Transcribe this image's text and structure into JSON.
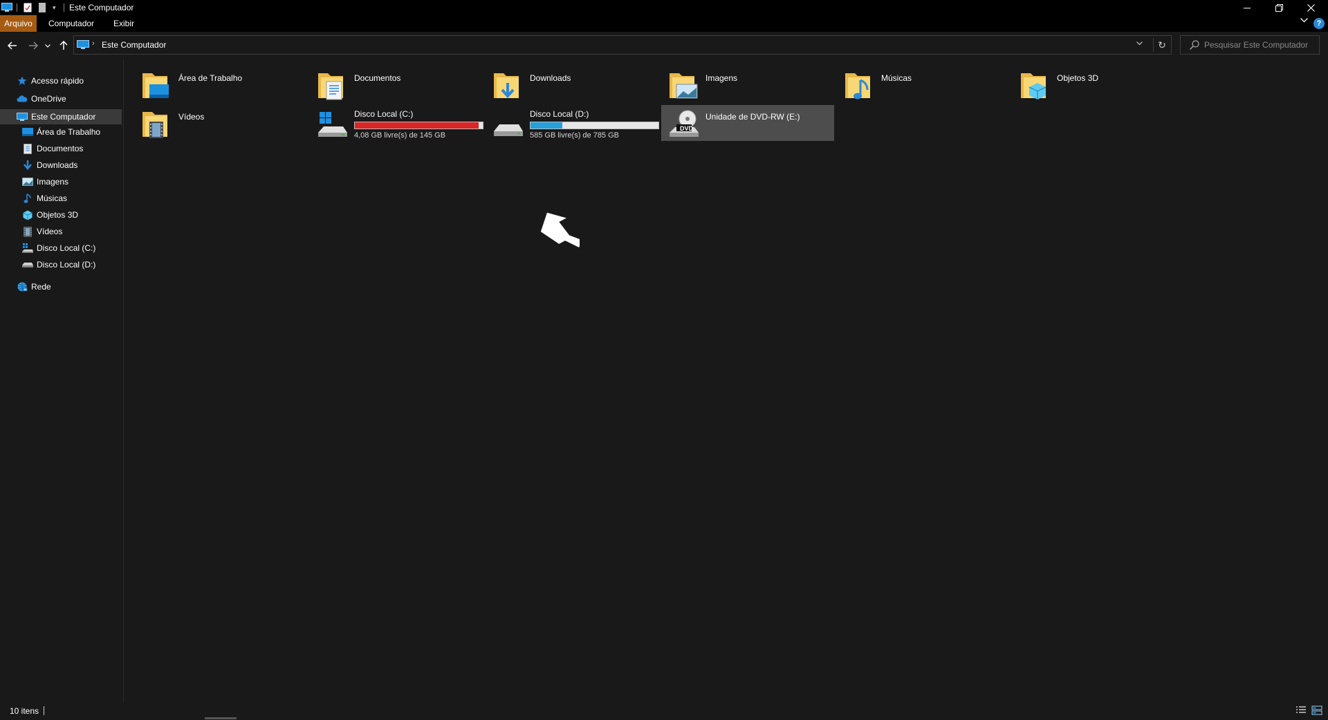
{
  "window": {
    "title": "Este Computador"
  },
  "ribbon": {
    "tabs": [
      {
        "label": "Arquivo"
      },
      {
        "label": "Computador"
      },
      {
        "label": "Exibir"
      }
    ],
    "help_label": "?"
  },
  "address": {
    "path_label": "Este Computador",
    "search_placeholder": "Pesquisar Este Computador"
  },
  "navpane": {
    "quick_access": "Acesso rápido",
    "onedrive": "OneDrive",
    "this_pc": "Este Computador",
    "children": [
      {
        "label": "Área de Trabalho",
        "icon": "desktop-icon"
      },
      {
        "label": "Documentos",
        "icon": "documents-icon"
      },
      {
        "label": "Downloads",
        "icon": "downloads-icon"
      },
      {
        "label": "Imagens",
        "icon": "pictures-icon"
      },
      {
        "label": "Músicas",
        "icon": "music-icon"
      },
      {
        "label": "Objetos 3D",
        "icon": "3d-objects-icon"
      },
      {
        "label": "Vídeos",
        "icon": "videos-icon"
      },
      {
        "label": "Disco Local (C:)",
        "icon": "system-drive-icon"
      },
      {
        "label": "Disco Local (D:)",
        "icon": "drive-icon"
      }
    ],
    "network": "Rede"
  },
  "folders": [
    {
      "label": "Área de Trabalho",
      "icon": "desktop-folder-icon"
    },
    {
      "label": "Documentos",
      "icon": "documents-folder-icon"
    },
    {
      "label": "Downloads",
      "icon": "downloads-folder-icon"
    },
    {
      "label": "Imagens",
      "icon": "pictures-folder-icon"
    },
    {
      "label": "Músicas",
      "icon": "music-folder-icon"
    },
    {
      "label": "Objetos 3D",
      "icon": "3d-objects-folder-icon"
    },
    {
      "label": "Vídeos",
      "icon": "videos-folder-icon"
    }
  ],
  "drives": [
    {
      "label": "Disco Local (C:)",
      "free_text": "4,08 GB livre(s) de 145 GB",
      "used_fraction": 0.97,
      "bar_color": "#da2626",
      "icon": "system-drive-icon"
    },
    {
      "label": "Disco Local (D:)",
      "free_text": "585 GB livre(s) de 785 GB",
      "used_fraction": 0.25,
      "bar_color": "#26a0da",
      "icon": "drive-icon"
    },
    {
      "label": "Unidade de DVD-RW (E:)",
      "icon": "dvd-drive-icon",
      "dvd_badge": "DVD"
    }
  ],
  "status": {
    "count": "10 itens"
  },
  "colors": {
    "accent_file_tab": "#a65b12",
    "background": "#191919",
    "selection": "#4d4d4d"
  }
}
